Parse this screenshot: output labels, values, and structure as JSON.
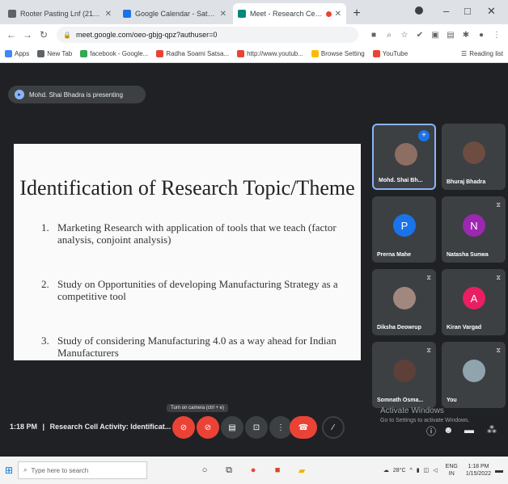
{
  "browser": {
    "tabs": [
      {
        "title": "Rooter Pasting Lnf (21100) -",
        "fav": "#5f6368",
        "active": false
      },
      {
        "title": "Google Calendar - Saturday, 1/...",
        "fav": "#1a73e8",
        "active": false
      },
      {
        "title": "Meet - Research Cell Activ...",
        "fav": "#00897b",
        "active": true
      }
    ],
    "new_tab": "+",
    "url": "meet.google.com/oeo-gbjg-qpz?authuser=0",
    "bookmarks": [
      {
        "label": "Apps",
        "color": "#4285f4"
      },
      {
        "label": "New Tab",
        "color": "#5f6368"
      },
      {
        "label": "facebook - Google...",
        "color": "#34a853"
      },
      {
        "label": "Radha Soami Satsa...",
        "color": "#ea4335"
      },
      {
        "label": "http://www.youtub...",
        "color": "#ea4335"
      },
      {
        "label": "Browse Setting",
        "color": "#fbbc05"
      },
      {
        "label": "YouTube",
        "color": "#ea4335"
      }
    ],
    "reading_list": "Reading list"
  },
  "meet": {
    "presenting_label": "Mohd. Shai Bhadra is presenting",
    "slide": {
      "title": "Identification of Research Topic/Theme",
      "items": [
        {
          "num": "1.",
          "text": "Marketing Research with application of tools that we teach (factor analysis, conjoint analysis)"
        },
        {
          "num": "2.",
          "text": "Study on Opportunities of developing Manufacturing Strategy as a competitive tool"
        },
        {
          "num": "3.",
          "text": "Study of considering Manufacturing 4.0 as a way ahead for Indian Manufacturers"
        }
      ]
    },
    "participants": [
      {
        "name": "Mohd. Shai Bh...",
        "initial": "",
        "color": "#8d6e63",
        "active": true
      },
      {
        "name": "Bhuraj Bhadra",
        "initial": "",
        "color": "#6d4c41",
        "active": false
      },
      {
        "name": "Prerna Mahe",
        "initial": "P",
        "color": "#1a73e8",
        "active": false
      },
      {
        "name": "Natasha Sunwa",
        "initial": "N",
        "color": "#9c27b0",
        "active": false
      },
      {
        "name": "Diksha Deowrup",
        "initial": "",
        "color": "#a1887f",
        "active": false
      },
      {
        "name": "Kiran Vargad",
        "initial": "A",
        "color": "#e91e63",
        "active": false
      },
      {
        "name": "Somnath Osma...",
        "initial": "",
        "color": "#5d4037",
        "active": false
      },
      {
        "name": "You",
        "initial": "",
        "color": "#90a4ae",
        "active": false
      }
    ],
    "time": "1:18 PM",
    "separator": "|",
    "meeting_title": "Research Cell Activity: Identificat...",
    "tooltip": "Turn on camera (ctrl + e)",
    "activate_title": "Activate Windows",
    "activate_sub": "Go to Settings to activate Windows."
  },
  "taskbar": {
    "search_placeholder": "Type here to search",
    "weather": "28°C",
    "lang": "ENG",
    "region": "IN",
    "time": "1:18 PM",
    "date": "1/15/2022"
  }
}
